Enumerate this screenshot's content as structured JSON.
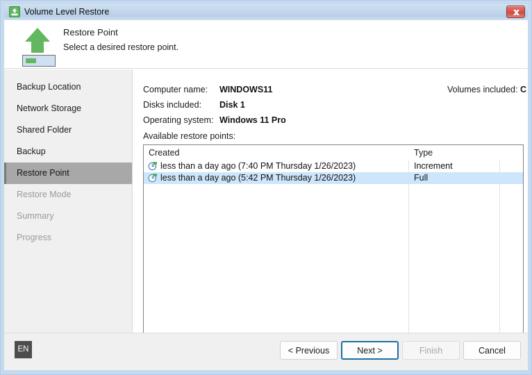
{
  "window": {
    "title": "Volume Level Restore",
    "title_icon": "volume-restore-icon",
    "close_label": "x"
  },
  "header": {
    "icon": "green-up-arrow-volume-icon",
    "title": "Restore Point",
    "subtitle": "Select a desired restore point."
  },
  "sidebar": {
    "items": [
      {
        "label": "Backup Location",
        "state": "normal"
      },
      {
        "label": "Network Storage",
        "state": "normal"
      },
      {
        "label": "Shared Folder",
        "state": "normal"
      },
      {
        "label": "Backup",
        "state": "normal"
      },
      {
        "label": "Restore Point",
        "state": "selected"
      },
      {
        "label": "Restore Mode",
        "state": "disabled"
      },
      {
        "label": "Summary",
        "state": "disabled"
      },
      {
        "label": "Progress",
        "state": "disabled"
      }
    ]
  },
  "main": {
    "computer_name_label": "Computer name:",
    "computer_name_value": "WINDOWS11",
    "disks_label": "Disks included:",
    "disks_value": "Disk 1",
    "os_label": "Operating system:",
    "os_value": "Windows 11 Pro",
    "volumes_label": "Volumes included:",
    "volumes_value": "C",
    "list_caption": "Available restore points:",
    "columns": [
      "Created",
      "Type"
    ],
    "rows": [
      {
        "icon": "restore-point-clock-icon",
        "created": "less than a day ago (7:40 PM Thursday 1/26/2023)",
        "type": "Increment",
        "selected": false
      },
      {
        "icon": "restore-point-clock-icon",
        "created": "less than a day ago (5:42 PM Thursday 1/26/2023)",
        "type": "Full",
        "selected": true
      }
    ]
  },
  "footer": {
    "language": "EN",
    "previous_label": "< Previous",
    "next_label": "Next >",
    "finish_label": "Finish",
    "cancel_label": "Cancel"
  },
  "colors": {
    "accent_green": "#5cb85c",
    "selection_blue": "#cde6fb",
    "focus_blue": "#1c6ea4",
    "close_red": "#d9574e",
    "sidebar_selected": "#a8a8a8"
  }
}
